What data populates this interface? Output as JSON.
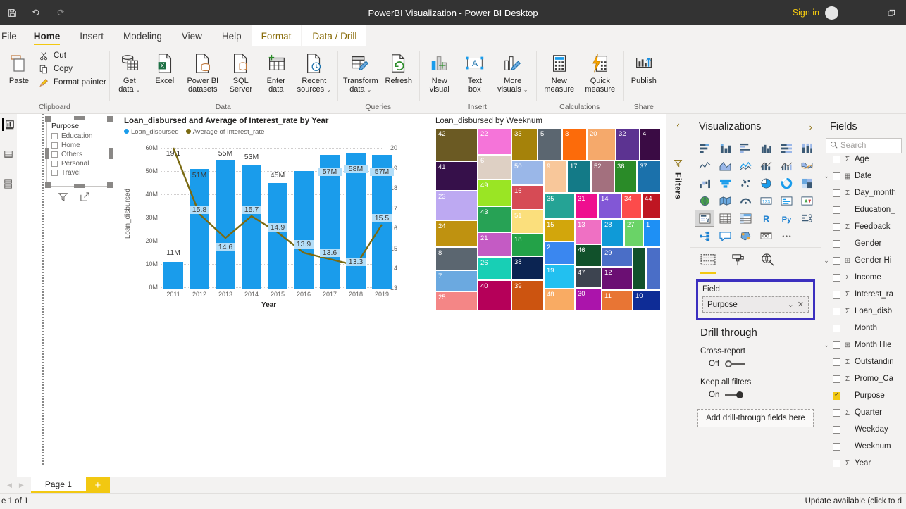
{
  "titlebar": {
    "title": "PowerBI Visualization - Power BI Desktop",
    "signin": "Sign in",
    "quick_icons": [
      "save-icon",
      "undo-icon",
      "redo-icon"
    ],
    "window_buttons": [
      "minimize-icon",
      "restore-icon"
    ]
  },
  "ribbon": {
    "file_label": "File",
    "tabs": [
      {
        "label": "Home",
        "active": true,
        "contextual": false
      },
      {
        "label": "Insert",
        "active": false,
        "contextual": false
      },
      {
        "label": "Modeling",
        "active": false,
        "contextual": false
      },
      {
        "label": "View",
        "active": false,
        "contextual": false
      },
      {
        "label": "Help",
        "active": false,
        "contextual": false
      },
      {
        "label": "Format",
        "active": false,
        "contextual": true
      },
      {
        "label": "Data / Drill",
        "active": false,
        "contextual": true
      }
    ],
    "groups": [
      {
        "name": "Clipboard",
        "label": "Clipboard",
        "paste_label": "Paste",
        "small_items": [
          {
            "label": "Cut",
            "icon": "scissors-icon"
          },
          {
            "label": "Copy",
            "icon": "copy-icon"
          },
          {
            "label": "Format painter",
            "icon": "paintbrush-icon"
          }
        ]
      },
      {
        "name": "Data",
        "label": "Data",
        "items": [
          {
            "label": "Get",
            "label2": "data",
            "caret": true,
            "icon": "get-data-icon"
          },
          {
            "label": "Excel",
            "label2": "",
            "caret": false,
            "icon": "excel-icon"
          },
          {
            "label": "Power BI",
            "label2": "datasets",
            "caret": false,
            "icon": "powerbi-datasets-icon"
          },
          {
            "label": "SQL",
            "label2": "Server",
            "caret": false,
            "icon": "sql-server-icon"
          },
          {
            "label": "Enter",
            "label2": "data",
            "caret": false,
            "icon": "enter-data-icon"
          },
          {
            "label": "Recent",
            "label2": "sources",
            "caret": true,
            "icon": "recent-sources-icon"
          }
        ]
      },
      {
        "name": "Queries",
        "label": "Queries",
        "items": [
          {
            "label": "Transform",
            "label2": "data",
            "caret": true,
            "icon": "transform-data-icon"
          },
          {
            "label": "Refresh",
            "label2": "",
            "caret": false,
            "icon": "refresh-icon"
          }
        ]
      },
      {
        "name": "Insert",
        "label": "Insert",
        "items": [
          {
            "label": "New",
            "label2": "visual",
            "caret": false,
            "icon": "new-visual-icon"
          },
          {
            "label": "Text",
            "label2": "box",
            "caret": false,
            "icon": "text-box-icon"
          },
          {
            "label": "More",
            "label2": "visuals",
            "caret": true,
            "icon": "more-visuals-icon"
          }
        ]
      },
      {
        "name": "Calculations",
        "label": "Calculations",
        "items": [
          {
            "label": "New",
            "label2": "measure",
            "caret": false,
            "icon": "new-measure-icon"
          },
          {
            "label": "Quick",
            "label2": "measure",
            "caret": false,
            "icon": "quick-measure-icon"
          }
        ]
      },
      {
        "name": "Share",
        "label": "Share",
        "items": [
          {
            "label": "Publish",
            "label2": "",
            "caret": false,
            "icon": "publish-icon"
          }
        ]
      }
    ]
  },
  "leftrail": {
    "items": [
      "report-view-icon",
      "data-view-icon",
      "model-view-icon"
    ]
  },
  "slicer": {
    "title": "Purpose",
    "items": [
      "Education",
      "Home",
      "Others",
      "Personal",
      "Travel"
    ],
    "tools": [
      "filter-icon",
      "focus-mode-icon"
    ]
  },
  "chart_data": [
    {
      "type": "bar",
      "name": "combo-chart",
      "title": "Loan_disbursed and Average of Interest_rate by Year",
      "xlabel": "Year",
      "ylabel": "Loan_disbursed",
      "y2label": "",
      "categories": [
        "2011",
        "2012",
        "2013",
        "2014",
        "2015",
        "2016",
        "2017",
        "2018",
        "2019"
      ],
      "ylim": [
        0,
        60000000
      ],
      "yticks": [
        "0M",
        "10M",
        "20M",
        "30M",
        "40M",
        "50M",
        "60M"
      ],
      "y2lim": [
        13,
        20
      ],
      "y2ticks": [
        "13",
        "14",
        "15",
        "16",
        "17",
        "18",
        "19",
        "20"
      ],
      "grid": true,
      "legend_position": "top",
      "series": [
        {
          "name": "Loan_disbursed",
          "type": "bar",
          "color": "#1a9ceb",
          "values": [
            11000000,
            51000000,
            55000000,
            53000000,
            45000000,
            50000000,
            57000000,
            58000000,
            57000000
          ],
          "labels": [
            "11M",
            "51M",
            "55M",
            "53M",
            "45M",
            "50M",
            "57M",
            "58M",
            "57M"
          ],
          "shown_labels": [
            "11M",
            "51M",
            "55M",
            "53M",
            "45M",
            "",
            "57M",
            "58M",
            "57M"
          ]
        },
        {
          "name": "Average of Interest_rate",
          "type": "line",
          "color": "#7a6a12",
          "values": [
            19.1,
            15.8,
            14.6,
            15.7,
            14.9,
            13.9,
            13.6,
            13.3,
            15.5
          ],
          "labels": [
            "19.1",
            "15.8",
            "14.6",
            "15.7",
            "14.9",
            "13.9",
            "13.6",
            "13.3",
            "15.5"
          ]
        }
      ]
    },
    {
      "type": "treemap",
      "name": "treemap-chart",
      "title": "Loan_disbursed by Weeknum",
      "tiles": [
        {
          "label": "42",
          "color": "#6b5a23"
        },
        {
          "label": "22",
          "color": "#f574d9"
        },
        {
          "label": "33",
          "color": "#a5820a"
        },
        {
          "label": "5",
          "color": "#5b6670"
        },
        {
          "label": "3",
          "color": "#fc6b0a"
        },
        {
          "label": "20",
          "color": "#f5a96b"
        },
        {
          "label": "32",
          "color": "#5c3391"
        },
        {
          "label": "4",
          "color": "#3a0b44"
        },
        {
          "label": "41",
          "color": "#36104a"
        },
        {
          "label": "6",
          "color": "#ded0c4"
        },
        {
          "label": "50",
          "color": "#9ab7e8"
        },
        {
          "label": "9",
          "color": "#f8c79a"
        },
        {
          "label": "17",
          "color": "#137a87"
        },
        {
          "label": "52",
          "color": "#a3707e"
        },
        {
          "label": "36",
          "color": "#2a8b28"
        },
        {
          "label": "37",
          "color": "#1b71ab"
        },
        {
          "label": "23",
          "color": "#bda9f2"
        },
        {
          "label": "49",
          "color": "#9ae524"
        },
        {
          "label": "16",
          "color": "#d64b55"
        },
        {
          "label": "35",
          "color": "#25a395"
        },
        {
          "label": "31",
          "color": "#ef0f8f"
        },
        {
          "label": "14",
          "color": "#8257d6"
        },
        {
          "label": "34",
          "color": "#fc4b4b"
        },
        {
          "label": "44",
          "color": "#bf1622"
        },
        {
          "label": "24",
          "color": "#bf9210"
        },
        {
          "label": "43",
          "color": "#27a255"
        },
        {
          "label": "51",
          "color": "#fbdf7c"
        },
        {
          "label": "15",
          "color": "#d2a60c"
        },
        {
          "label": "13",
          "color": "#ef70c3"
        },
        {
          "label": "28",
          "color": "#0f9ad7"
        },
        {
          "label": "27",
          "color": "#6ad367"
        },
        {
          "label": "1",
          "color": "#1e90f5"
        },
        {
          "label": "8",
          "color": "#5b6670"
        },
        {
          "label": "21",
          "color": "#c45bc4"
        },
        {
          "label": "18",
          "color": "#23a248"
        },
        {
          "label": "2",
          "color": "#3a87f0"
        },
        {
          "label": "46",
          "color": "#11512b"
        },
        {
          "label": "29",
          "color": "#4a6ec7"
        },
        {
          "label": "12",
          "color": "#6b0f73"
        },
        {
          "label": "7",
          "color": "#6ba9e0"
        },
        {
          "label": "26",
          "color": "#18cfb5"
        },
        {
          "label": "38",
          "color": "#0b2452"
        },
        {
          "label": "19",
          "color": "#22c0f0"
        },
        {
          "label": "47",
          "color": "#3d4450"
        },
        {
          "label": "25",
          "color": "#f48686"
        },
        {
          "label": "40",
          "color": "#b50059"
        },
        {
          "label": "39",
          "color": "#cc5410"
        },
        {
          "label": "48",
          "color": "#f9ab63"
        },
        {
          "label": "30",
          "color": "#ab14ab"
        },
        {
          "label": "11",
          "color": "#e87534"
        },
        {
          "label": "10",
          "color": "#0e2c96"
        }
      ]
    }
  ],
  "filters_rail": {
    "label": "Filters",
    "collapse_icon": "chevron-left-icon",
    "filter_icon": "filter-icon"
  },
  "visualizations": {
    "title": "Visualizations",
    "expand_icon": "chevron-right-icon",
    "icons": [
      "stacked-bar-chart-icon",
      "stacked-column-chart-icon",
      "clustered-bar-chart-icon",
      "clustered-column-chart-icon",
      "100-stacked-bar-chart-icon",
      "100-stacked-column-chart-icon",
      "line-chart-icon",
      "area-chart-icon",
      "stacked-area-chart-icon",
      "line-stacked-column-chart-icon",
      "line-clustered-column-chart-icon",
      "ribbon-chart-icon",
      "waterfall-chart-icon",
      "funnel-chart-icon",
      "scatter-chart-icon",
      "pie-chart-icon",
      "donut-chart-icon",
      "treemap-icon",
      "map-icon",
      "filled-map-icon",
      "arcgis-map-icon",
      "card-icon",
      "multirow-card-icon",
      "kpi-icon",
      "slicer-icon",
      "table-icon",
      "matrix-icon",
      "r-script-visual-icon",
      "python-visual-icon",
      "key-influencers-icon",
      "decomposition-tree-icon",
      "qa-visual-icon",
      "smart-narrative-icon",
      "paginated-report-icon",
      "more-options-icon"
    ],
    "selected_icon_index": 24,
    "tabs": [
      "fields-tab-icon",
      "format-tab-icon",
      "analytics-tab-icon"
    ],
    "active_tab_index": 0,
    "field_section": {
      "label": "Field",
      "value": "Purpose",
      "dropdown_icon": "chevron-down-icon",
      "remove_icon": "close-icon"
    },
    "drill_through": {
      "heading": "Drill through",
      "cross_report_label": "Cross-report",
      "cross_report_state": "Off",
      "keep_filters_label": "Keep all filters",
      "keep_filters_state": "On",
      "dropzone": "Add drill-through fields here"
    }
  },
  "fields": {
    "title": "Fields",
    "search_placeholder": "Search",
    "search_icon": "search-icon",
    "items": [
      {
        "label": "Age",
        "type": "sigma",
        "checked": false,
        "expand": false,
        "indent": 1,
        "clipped": true
      },
      {
        "label": "Date",
        "type": "calendar",
        "checked": false,
        "expand": true,
        "indent": 0
      },
      {
        "label": "Day_month",
        "type": "sigma",
        "checked": false,
        "expand": false,
        "indent": 1
      },
      {
        "label": "Education_",
        "type": "",
        "checked": false,
        "expand": false,
        "indent": 1
      },
      {
        "label": "Feedback",
        "type": "sigma",
        "checked": false,
        "expand": false,
        "indent": 1
      },
      {
        "label": "Gender",
        "type": "",
        "checked": false,
        "expand": false,
        "indent": 1
      },
      {
        "label": "Gender Hi",
        "type": "hierarchy",
        "checked": false,
        "expand": true,
        "indent": 0
      },
      {
        "label": "Income",
        "type": "sigma",
        "checked": false,
        "expand": false,
        "indent": 1
      },
      {
        "label": "Interest_ra",
        "type": "sigma",
        "checked": false,
        "expand": false,
        "indent": 1
      },
      {
        "label": "Loan_disb",
        "type": "sigma",
        "checked": false,
        "expand": false,
        "indent": 1
      },
      {
        "label": "Month",
        "type": "",
        "checked": false,
        "expand": false,
        "indent": 1
      },
      {
        "label": "Month Hie",
        "type": "hierarchy",
        "checked": false,
        "expand": true,
        "indent": 0
      },
      {
        "label": "Outstandin",
        "type": "sigma",
        "checked": false,
        "expand": false,
        "indent": 1
      },
      {
        "label": "Promo_Ca",
        "type": "sigma",
        "checked": false,
        "expand": false,
        "indent": 1
      },
      {
        "label": "Purpose",
        "type": "",
        "checked": true,
        "expand": false,
        "indent": 1
      },
      {
        "label": "Quarter",
        "type": "sigma",
        "checked": false,
        "expand": false,
        "indent": 1
      },
      {
        "label": "Weekday",
        "type": "",
        "checked": false,
        "expand": false,
        "indent": 1
      },
      {
        "label": "Weeknum",
        "type": "",
        "checked": false,
        "expand": false,
        "indent": 1
      },
      {
        "label": "Year",
        "type": "sigma",
        "checked": false,
        "expand": false,
        "indent": 1
      }
    ]
  },
  "bottom": {
    "page_tabs": [
      "Page 1"
    ],
    "add_page_icon": "plus-icon",
    "prev_icon": "triangle-left-icon",
    "next_icon": "triangle-right-icon",
    "status_left": "e 1 of 1",
    "status_right": "Update available (click to d"
  },
  "colors": {
    "accent": "#f2c811",
    "bar": "#1a9ceb",
    "line": "#7a6a12",
    "highlight_border": "#3b2fbf"
  }
}
